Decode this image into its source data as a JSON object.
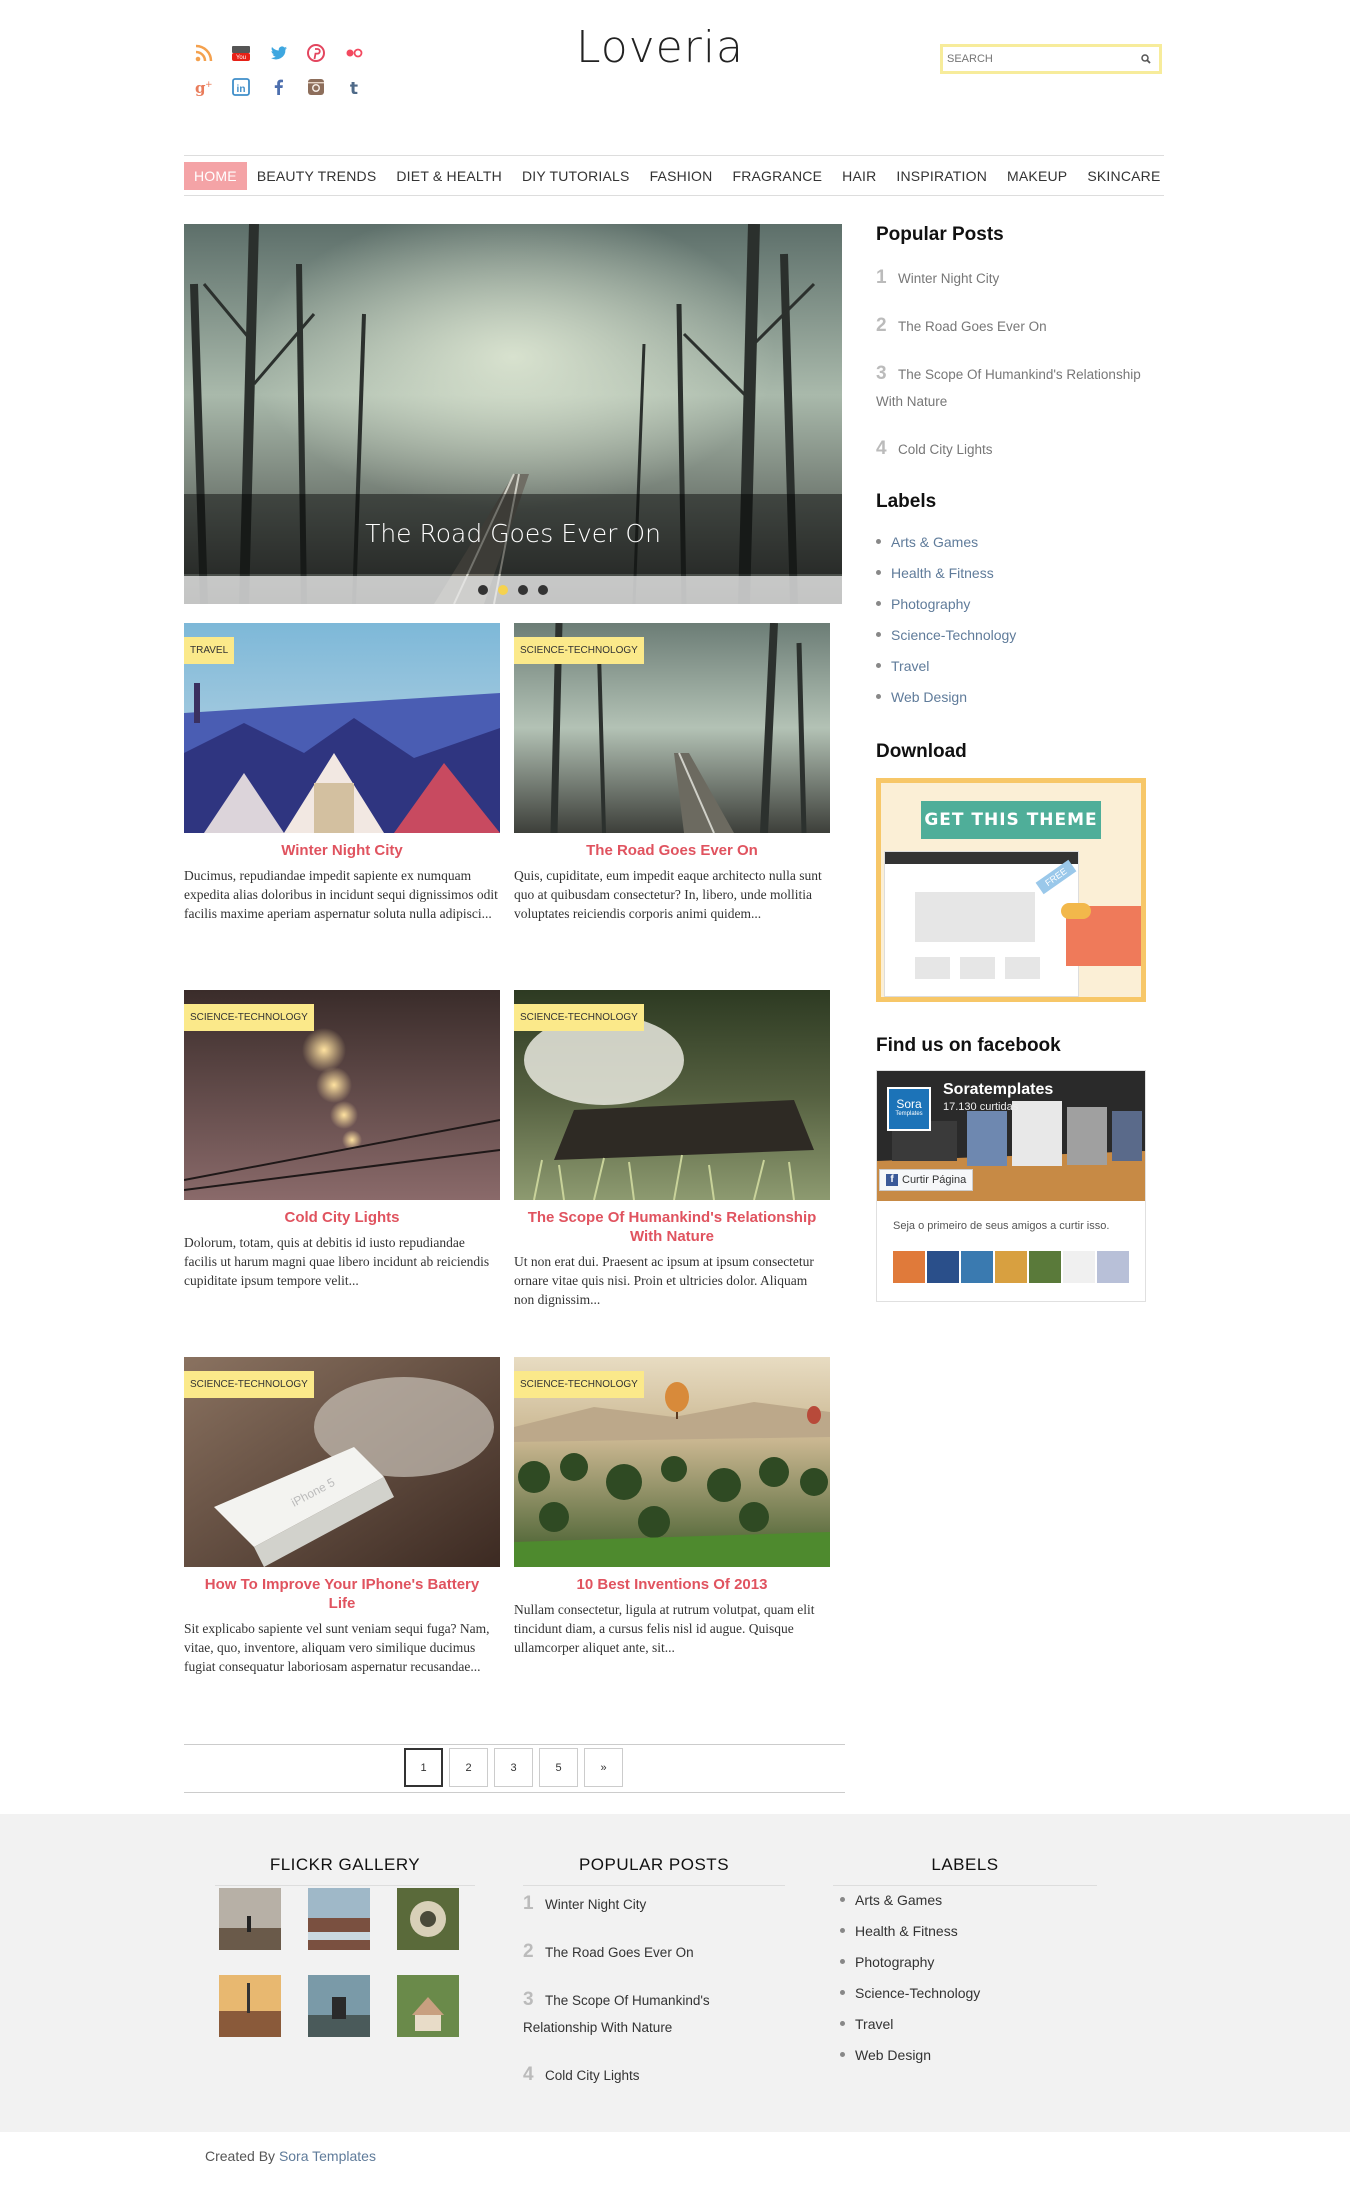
{
  "header": {
    "logo": "Loveria",
    "search_placeholder": "SEARCH",
    "social": [
      {
        "name": "rss-icon",
        "color": "#f4a14e"
      },
      {
        "name": "youtube-icon",
        "color": "#e62117"
      },
      {
        "name": "twitter-icon",
        "color": "#3ea7e0"
      },
      {
        "name": "pinterest-icon",
        "color": "#e3455e"
      },
      {
        "name": "flickr-icon",
        "color": "#f3495f"
      },
      {
        "name": "googleplus-icon",
        "color": "#e97c5b"
      },
      {
        "name": "linkedin-icon",
        "color": "#3f8ec9"
      },
      {
        "name": "facebook-icon",
        "color": "#4d6fae"
      },
      {
        "name": "instagram-icon",
        "color": "#8d6e5b"
      },
      {
        "name": "tumblr-icon",
        "color": "#4f6a88"
      }
    ]
  },
  "nav": {
    "items": [
      "HOME",
      "BEAUTY TRENDS",
      "DIET & HEALTH",
      "DIY TUTORIALS",
      "FASHION",
      "FRAGRANCE",
      "HAIR",
      "INSPIRATION",
      "MAKEUP",
      "SKINCARE"
    ],
    "active_index": 0
  },
  "slider": {
    "caption": "The Road Goes Ever On",
    "dots": 4,
    "active_dot": 1
  },
  "posts": [
    {
      "label": "TRAVEL",
      "title": "Winter Night City",
      "excerpt": "Ducimus, repudiandae impedit sapiente ex numquam expedita alias doloribus in incidunt sequi dignissimos odit facilis maxime aperiam aspernatur soluta nulla adipisci..."
    },
    {
      "label": "SCIENCE-TECHNOLOGY",
      "title": "The Road Goes Ever On",
      "excerpt": "Quis, cupiditate, eum impedit eaque architecto nulla sunt quo at quibusdam consectetur? In, libero, unde mollitia voluptates reiciendis corporis animi quidem..."
    },
    {
      "label": "SCIENCE-TECHNOLOGY",
      "title": "Cold City Lights",
      "excerpt": "Dolorum, totam, quis at debitis id iusto repudiandae facilis ut harum magni quae libero incidunt ab reiciendis cupiditate ipsum tempore velit..."
    },
    {
      "label": "SCIENCE-TECHNOLOGY",
      "title": "The Scope Of Humankind's Relationship With Nature",
      "excerpt": "Ut non erat dui. Praesent ac ipsum at ipsum consectetur ornare vitae quis nisi. Proin et ultricies dolor. Aliquam non dignissim..."
    },
    {
      "label": "SCIENCE-TECHNOLOGY",
      "title": "How To Improve Your IPhone's Battery Life",
      "excerpt": "Sit explicabo sapiente vel sunt veniam sequi fuga? Nam, vitae, quo, inventore, aliquam vero similique ducimus fugiat consequatur laboriosam aspernatur recusandae..."
    },
    {
      "label": "SCIENCE-TECHNOLOGY",
      "title": "10 Best Inventions Of 2013",
      "excerpt": "Nullam consectetur, ligula at rutrum volutpat, quam elit tincidunt diam, a cursus felis nisl id augue. Quisque ullamcorper aliquet ante, sit..."
    }
  ],
  "pagination": {
    "pages": [
      "1",
      "2",
      "3",
      "5",
      "»"
    ],
    "active": "1"
  },
  "sidebar": {
    "popular_title": "Popular Posts",
    "popular": [
      {
        "num": "1",
        "title": "Winter Night City"
      },
      {
        "num": "2",
        "title": "The Road Goes Ever On"
      },
      {
        "num": "3",
        "title": "The Scope Of Humankind's Relationship With Nature"
      },
      {
        "num": "4",
        "title": "Cold City Lights"
      }
    ],
    "labels_title": "Labels",
    "labels": [
      "Arts & Games",
      "Health & Fitness",
      "Photography",
      "Science-Technology",
      "Travel",
      "Web Design"
    ],
    "download_title": "Download",
    "download_banner": "GET THIS THEME",
    "download_badge": "FREE",
    "facebook_title": "Find us on facebook",
    "facebook": {
      "page_name": "Soratemplates",
      "likes": "17.130 curtidas",
      "logo_text": "Sora",
      "logo_subtext": "Templates",
      "like_button": "Curtir Página",
      "friends_text": "Seja o primeiro de seus amigos a curtir isso."
    }
  },
  "footer": {
    "flickr_title": "FLICKR GALLERY",
    "popular_title": "POPULAR POSTS",
    "labels_title": "LABELS",
    "credit_prefix": "Created By ",
    "credit_link": "Sora Templates"
  },
  "colors": {
    "accent_pink": "#f4a3a6",
    "title_red": "#e0535f",
    "label_yellow": "#fbe98a",
    "link_blue": "#5f7b9a"
  }
}
